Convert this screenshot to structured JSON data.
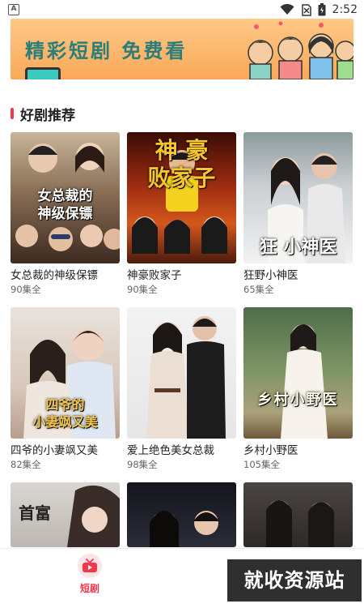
{
  "status_bar": {
    "notification_glyph": "A",
    "time": "2:52",
    "icons": [
      "wifi-icon",
      "no-sim-icon",
      "battery-icon"
    ]
  },
  "banner": {
    "text": "精彩短剧 免费看"
  },
  "section": {
    "title": "好剧推荐",
    "accent_color": "#f0384a"
  },
  "dramas": [
    {
      "title": "女总裁的神级保镖",
      "episodes": "90集全",
      "poster_caption": "女总裁的\n神级保镖"
    },
    {
      "title": "神豪败家子",
      "episodes": "90集全",
      "poster_caption": "神 豪\n败家子"
    },
    {
      "title": "狂野小神医",
      "episodes": "65集全",
      "poster_caption": "狂 小神医"
    },
    {
      "title": "四爷的小妻飒又美",
      "episodes": "82集全",
      "poster_caption": "四爷的\n小妻飒又美"
    },
    {
      "title": "爱上绝色美女总裁",
      "episodes": "98集全",
      "poster_caption": ""
    },
    {
      "title": "乡村小野医",
      "episodes": "105集全",
      "poster_caption": "乡村小野医"
    },
    {
      "title": "",
      "episodes": "",
      "poster_caption": "首富"
    },
    {
      "title": "",
      "episodes": "",
      "poster_caption": ""
    },
    {
      "title": "",
      "episodes": "",
      "poster_caption": ""
    }
  ],
  "bottom_nav": {
    "active_tab_label": "短剧",
    "active_color": "#f0384a"
  },
  "watermark": "就收资源站"
}
